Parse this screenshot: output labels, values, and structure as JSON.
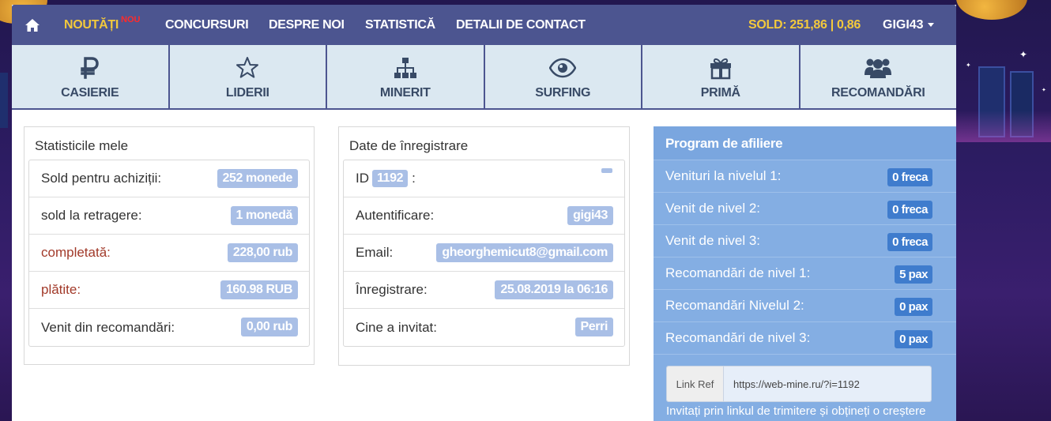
{
  "nav": {
    "news": "NOUTĂȚI",
    "news_badge": "NOU",
    "contests": "CONCURSURI",
    "about": "DESPRE NOI",
    "stats": "STATISTICĂ",
    "contact": "DETALII DE CONTACT",
    "balance": "SOLD: 251,86 | 0,86",
    "username": "GIGI43"
  },
  "tiles": [
    {
      "label": "CASIERIE",
      "icon": "ruble-icon"
    },
    {
      "label": "LIDERII",
      "icon": "star-icon"
    },
    {
      "label": "MINERIT",
      "icon": "sitemap-icon"
    },
    {
      "label": "SURFING",
      "icon": "eye-icon"
    },
    {
      "label": "PRIMĂ",
      "icon": "gift-icon"
    },
    {
      "label": "RECOMANDĂRI",
      "icon": "users-icon"
    }
  ],
  "stats": {
    "title": "Statisticile mele",
    "rows": [
      {
        "label": "Sold pentru achiziții:",
        "value": "252 monede"
      },
      {
        "label": "sold la retragere:",
        "value": "1 monedă"
      },
      {
        "label": "completată:",
        "value": "228,00 rub"
      },
      {
        "label": "plătite:",
        "value": "160.98 RUB"
      },
      {
        "label": "Venit din recomandări:",
        "value": "0,00 rub"
      }
    ]
  },
  "registration": {
    "title": "Date de înregistrare",
    "id_label": "ID",
    "id_value": "1192",
    "id_suffix": ":",
    "rows": [
      {
        "label": "Autentificare:",
        "value": "gigi43"
      },
      {
        "label": "Email:",
        "value": "gheorghemicut8@gmail.com"
      },
      {
        "label": "Înregistrare:",
        "value": "25.08.2019 la 06:16"
      },
      {
        "label": "Cine a invitat:",
        "value": "Perri"
      }
    ]
  },
  "affiliate": {
    "title": "Program de afiliere",
    "rows": [
      {
        "label": "Venituri la nivelul 1:",
        "value": "0 freca"
      },
      {
        "label": "Venit de nivel 2:",
        "value": "0 freca"
      },
      {
        "label": "Venit de nivel 3:",
        "value": "0 freca"
      },
      {
        "label": "Recomandări de nivel 1:",
        "value": "5 pax"
      },
      {
        "label": "Recomandări Nivelul 2:",
        "value": "0 pax"
      },
      {
        "label": "Recomandări de nivel 3:",
        "value": "0 pax"
      }
    ],
    "ref_label": "Link Ref",
    "ref_url": "https://web-mine.ru/?i=1192",
    "footer": "Invitați prin linkul de trimitere și obțineți o creștere"
  },
  "colors": {
    "nav_bg": "#4c5590",
    "accent_yellow": "#f3c93c",
    "badge_light": "#a9bfe6",
    "affiliate_bg": "#84aee3"
  }
}
